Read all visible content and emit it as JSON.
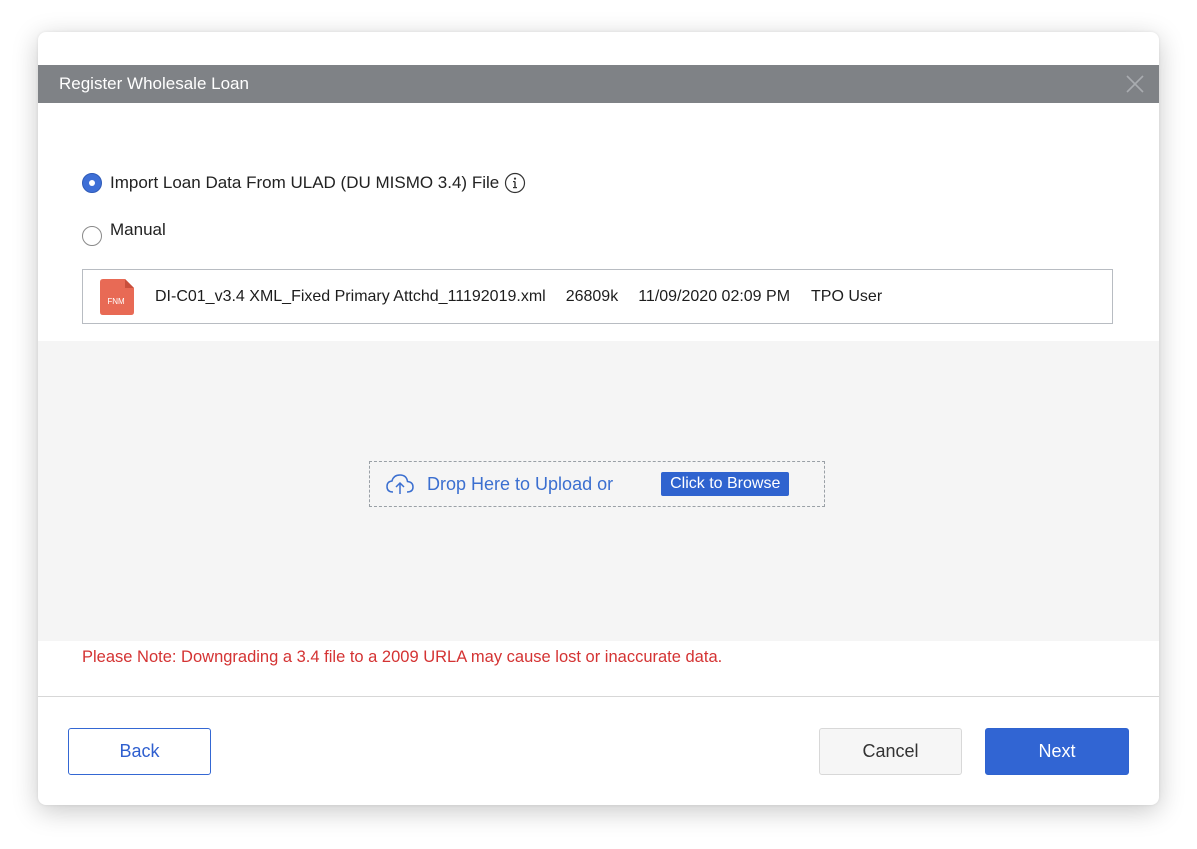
{
  "dialog": {
    "title": "Register Wholesale Loan"
  },
  "options": {
    "import_label": "Import Loan Data From ULAD (DU MISMO 3.4) File",
    "manual_label": "Manual",
    "selected": "import"
  },
  "file": {
    "icon_label": "FNM",
    "name": "DI-C01_v3.4 XML_Fixed Primary Attchd_11192019.xml",
    "size": "26809k",
    "date": "11/09/2020 02:09 PM",
    "user": "TPO User"
  },
  "upload": {
    "drop_text": "Drop Here to Upload or",
    "browse_label": "Click to Browse"
  },
  "note": "Please Note: Downgrading a 3.4 file to a 2009 URLA may cause lost or inaccurate data.",
  "footer": {
    "back_label": "Back",
    "cancel_label": "Cancel",
    "next_label": "Next"
  },
  "colors": {
    "accent": "#3165d3",
    "titlebar": "#7f8286",
    "warning": "#d43333",
    "file_icon": "#e86a55"
  },
  "icons": [
    "close-icon",
    "info-icon",
    "fnm-file-icon",
    "cloud-upload-icon"
  ]
}
